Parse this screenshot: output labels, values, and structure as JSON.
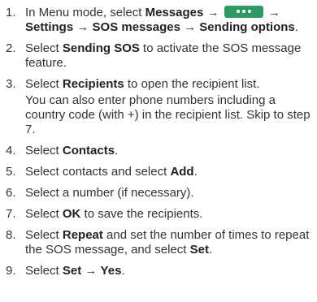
{
  "arrow": "→",
  "steps": [
    {
      "number": "1.",
      "prefix": "In Menu mode, select ",
      "messages": "Messages",
      "more_icon": "more-options-softkey-icon",
      "settings": "Settings",
      "sos_messages": "SOS messages",
      "sending_options": "Sending options",
      "suffix": "."
    },
    {
      "number": "2.",
      "prefix": "Select ",
      "bold": "Sending SOS",
      "suffix": " to activate the SOS message feature."
    },
    {
      "number": "3.",
      "prefix": "Select ",
      "bold": "Recipients",
      "suffix": " to open the recipient list."
    },
    {
      "number": "4.",
      "prefix": "Select ",
      "bold": "Contacts",
      "suffix": "."
    },
    {
      "number": "5.",
      "prefix": "Select contacts and select ",
      "bold": "Add",
      "suffix": "."
    },
    {
      "number": "6.",
      "text": "Select a number (if necessary)."
    },
    {
      "number": "7.",
      "prefix": "Select ",
      "bold": "OK",
      "suffix": " to save the recipients."
    },
    {
      "number": "8.",
      "prefix": "Select ",
      "bold": "Repeat",
      "middle": " and set the number of times to repeat the SOS message, and select ",
      "bold2": "Set",
      "suffix": "."
    },
    {
      "number": "9.",
      "prefix": "Select ",
      "bold": "Set",
      "bold2": "Yes",
      "suffix": "."
    }
  ],
  "note": "You can also enter phone numbers including a country code (with +) in the recipient list. Skip to step 7.",
  "colors": {
    "softkey_green": "#2f9a63",
    "text": "#333333"
  }
}
